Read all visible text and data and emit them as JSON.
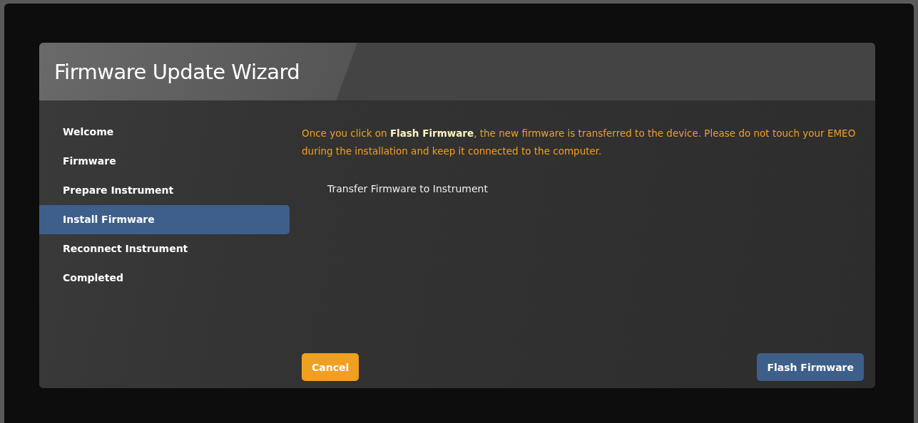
{
  "window": {
    "title": "Firmware Update Wizard"
  },
  "steps": [
    {
      "label": "Welcome",
      "selected": false
    },
    {
      "label": "Firmware",
      "selected": false
    },
    {
      "label": "Prepare Instrument",
      "selected": false
    },
    {
      "label": "Install Firmware",
      "selected": true
    },
    {
      "label": "Reconnect Instrument",
      "selected": false
    },
    {
      "label": "Completed",
      "selected": false
    }
  ],
  "notice": "Once you click on **Flash Firmware**, the new firmware is transferred to the device. Please do not touch your EMEO during the installation and keep it connected to the computer.",
  "task": "Transfer Firmware to Instrument",
  "buttons": [
    {
      "label": "Cancel",
      "kind": "cancel"
    },
    {
      "label": "Flash Firmware",
      "kind": "primary"
    }
  ]
}
